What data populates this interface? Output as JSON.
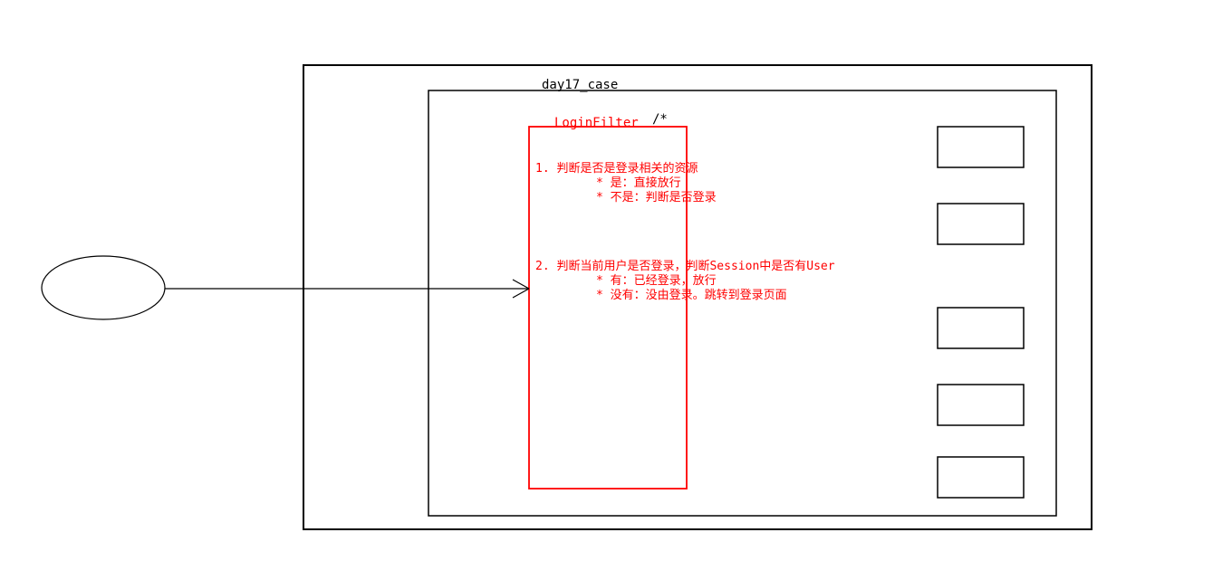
{
  "chart_data": {
    "type": "flowchart_diagram",
    "title": "day17_case",
    "filter": {
      "name": "LoginFilter",
      "url_pattern": "/*",
      "logic": [
        {
          "step": 1,
          "text": "判断是否是登录相关的资源",
          "branches": [
            "* 是：直接放行",
            "* 不是：判断是否登录"
          ]
        },
        {
          "step": 2,
          "text": "判断当前用户是否登录，判断Session中是否有User",
          "branches": [
            "* 有：已经登录，放行",
            "* 没有：没由登录。跳转到登录页面"
          ]
        }
      ]
    },
    "actors": {
      "client": "ellipse_left",
      "resource_boxes": 5
    },
    "arrows": [
      {
        "from": "client_ellipse",
        "to": "filter_box",
        "type": "line_with_arrowhead"
      }
    ]
  },
  "labels": {
    "outer_title": "day17_case",
    "filter_name": "LoginFilter",
    "url_pattern": "/*",
    "step1_heading": "1. 判断是否是登录相关的资源",
    "step1_bullet1": "* 是：直接放行",
    "step1_bullet2": "* 不是：判断是否登录",
    "step2_heading": "2. 判断当前用户是否登录，判断Session中是否有User",
    "step2_bullet1": "* 有：已经登录，放行",
    "step2_bullet2": "* 没有：没由登录。跳转到登录页面"
  }
}
